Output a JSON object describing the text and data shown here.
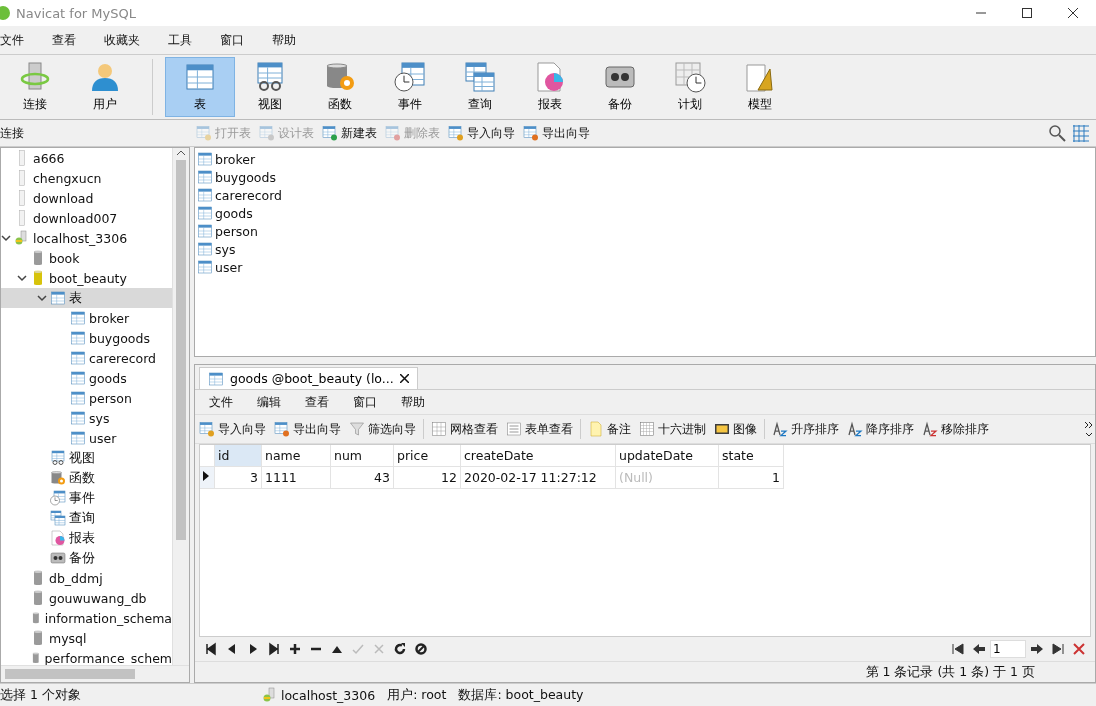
{
  "window": {
    "title": "Navicat for MySQL"
  },
  "menu": [
    "文件",
    "查看",
    "收藏夹",
    "工具",
    "窗口",
    "帮助"
  ],
  "toolbar": {
    "groups": [
      [
        {
          "label": "连接",
          "kind": "connection",
          "selected": false
        },
        {
          "label": "用户",
          "kind": "user",
          "selected": false
        }
      ],
      [
        {
          "label": "表",
          "kind": "table",
          "selected": true
        },
        {
          "label": "视图",
          "kind": "view",
          "selected": false
        },
        {
          "label": "函数",
          "kind": "function",
          "selected": false
        },
        {
          "label": "事件",
          "kind": "event",
          "selected": false
        },
        {
          "label": "查询",
          "kind": "query",
          "selected": false
        },
        {
          "label": "报表",
          "kind": "report",
          "selected": false
        },
        {
          "label": "备份",
          "kind": "backup",
          "selected": false
        },
        {
          "label": "计划",
          "kind": "schedule",
          "selected": false
        },
        {
          "label": "模型",
          "kind": "model",
          "selected": false
        }
      ]
    ]
  },
  "sidebar": {
    "title": "连接",
    "tree": [
      {
        "label": "a666",
        "kind": "connection-off",
        "selected": false
      },
      {
        "label": "chengxucn",
        "kind": "connection-off",
        "selected": false
      },
      {
        "label": "download",
        "kind": "connection-off",
        "selected": false
      },
      {
        "label": "download007",
        "kind": "connection-off",
        "selected": false
      },
      {
        "label": "localhost_3306",
        "kind": "connection-on",
        "selected": false,
        "expanded": true,
        "children": [
          {
            "label": "book",
            "kind": "database",
            "selected": false
          },
          {
            "label": "boot_beauty",
            "kind": "database-open",
            "selected": false,
            "expanded": true,
            "children": [
              {
                "label": "表",
                "kind": "table",
                "selected": true,
                "expanded": true,
                "children": [
                  {
                    "label": "broker",
                    "kind": "table",
                    "selected": false
                  },
                  {
                    "label": "buygoods",
                    "kind": "table",
                    "selected": false
                  },
                  {
                    "label": "carerecord",
                    "kind": "table",
                    "selected": false
                  },
                  {
                    "label": "goods",
                    "kind": "table",
                    "selected": false
                  },
                  {
                    "label": "person",
                    "kind": "table",
                    "selected": false
                  },
                  {
                    "label": "sys",
                    "kind": "table",
                    "selected": false
                  },
                  {
                    "label": "user",
                    "kind": "table",
                    "selected": false
                  }
                ]
              },
              {
                "label": "视图",
                "kind": "view",
                "selected": false
              },
              {
                "label": "函数",
                "kind": "function",
                "selected": false
              },
              {
                "label": "事件",
                "kind": "event",
                "selected": false
              },
              {
                "label": "查询",
                "kind": "query",
                "selected": false
              },
              {
                "label": "报表",
                "kind": "report",
                "selected": false
              },
              {
                "label": "备份",
                "kind": "backup",
                "selected": false
              }
            ]
          },
          {
            "label": "db_ddmj",
            "kind": "database",
            "selected": false
          },
          {
            "label": "gouwuwang_db",
            "kind": "database",
            "selected": false
          },
          {
            "label": "information_schema",
            "kind": "database",
            "selected": false
          },
          {
            "label": "mysql",
            "kind": "database",
            "selected": false
          },
          {
            "label": "performance_schem",
            "kind": "database",
            "selected": false
          }
        ]
      }
    ]
  },
  "object_toolbar": [
    {
      "label": "打开表",
      "kind": "open",
      "disabled": true
    },
    {
      "label": "设计表",
      "kind": "design",
      "disabled": true
    },
    {
      "label": "新建表",
      "kind": "new",
      "disabled": false
    },
    {
      "label": "删除表",
      "kind": "delete",
      "disabled": true
    },
    {
      "label": "导入向导",
      "kind": "import",
      "disabled": false
    },
    {
      "label": "导出向导",
      "kind": "export",
      "disabled": false
    }
  ],
  "object_list": [
    "broker",
    "buygoods",
    "carerecord",
    "goods",
    "person",
    "sys",
    "user"
  ],
  "editor": {
    "tab": {
      "title": "goods @boot_beauty (lo...",
      "selected": true
    },
    "menu": [
      "文件",
      "编辑",
      "查看",
      "窗口",
      "帮助"
    ],
    "toolbar": {
      "groups": [
        [
          {
            "label": "导入向导",
            "kind": "import"
          },
          {
            "label": "导出向导",
            "kind": "export"
          },
          {
            "label": "筛选向导",
            "kind": "filter"
          }
        ],
        [
          {
            "label": "网格查看",
            "kind": "grid"
          },
          {
            "label": "表单查看",
            "kind": "form"
          }
        ],
        [
          {
            "label": "备注",
            "kind": "memo"
          },
          {
            "label": "十六进制",
            "kind": "hex"
          },
          {
            "label": "图像",
            "kind": "image"
          }
        ],
        [
          {
            "label": "升序排序",
            "kind": "sort-asc"
          },
          {
            "label": "降序排序",
            "kind": "sort-desc"
          },
          {
            "label": "移除排序",
            "kind": "sort-remove"
          }
        ]
      ]
    },
    "grid": {
      "columns": [
        {
          "name": "id",
          "selected": true
        },
        {
          "name": "name",
          "selected": false
        },
        {
          "name": "num",
          "selected": false
        },
        {
          "name": "price",
          "selected": false
        },
        {
          "name": "createDate",
          "selected": false
        },
        {
          "name": "updateDate",
          "selected": false
        },
        {
          "name": "state",
          "selected": false
        }
      ],
      "rows": [
        {
          "current": true,
          "cells": [
            {
              "text": "3",
              "kind": "number"
            },
            {
              "text": "1111",
              "kind": "text"
            },
            {
              "text": "43",
              "kind": "number"
            },
            {
              "text": "12",
              "kind": "number"
            },
            {
              "text": "2020-02-17 11:27:12",
              "kind": "text"
            },
            {
              "text": "(Null)",
              "kind": "null"
            },
            {
              "text": "1",
              "kind": "number"
            }
          ]
        }
      ]
    },
    "nav": {
      "buttons": [
        {
          "kind": "first",
          "disabled": false
        },
        {
          "kind": "prev",
          "disabled": false
        },
        {
          "kind": "next",
          "disabled": false
        },
        {
          "kind": "last",
          "disabled": false
        },
        {
          "kind": "add",
          "disabled": false
        },
        {
          "kind": "delete",
          "disabled": false
        },
        {
          "kind": "up",
          "disabled": false
        },
        {
          "kind": "apply",
          "disabled": true
        },
        {
          "kind": "cancel",
          "disabled": true
        },
        {
          "kind": "refresh",
          "disabled": false
        },
        {
          "kind": "stop",
          "disabled": false
        }
      ],
      "page": "1",
      "record_info": "第 1 条记录 (共 1 条) 于 1 页"
    }
  },
  "status_bar": {
    "selection": "选择 1 个对象",
    "connection": "localhost_3306",
    "user": "用户: root",
    "database": "数据库: boot_beauty"
  }
}
